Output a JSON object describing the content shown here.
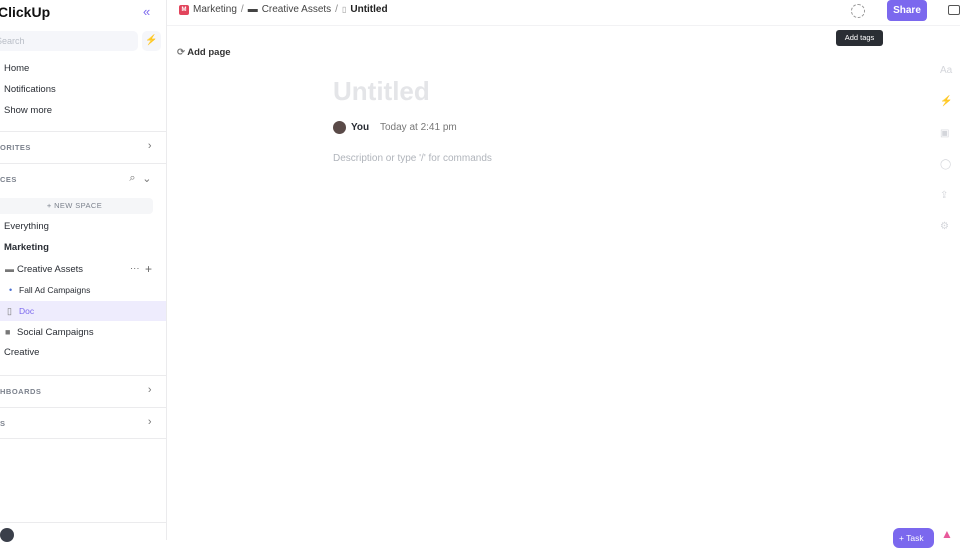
{
  "sidebar": {
    "logo": "ClickUp",
    "search_placeholder": "Search",
    "nav": [
      "Home",
      "Notifications",
      "Show more"
    ],
    "favorites": "ORITES",
    "spaces": "CES",
    "new_space": "+ NEW SPACE",
    "tree": [
      "Everything",
      "Marketing",
      "Creative Assets",
      "Fall Ad Campaigns",
      "Doc",
      "Social Campaigns",
      "Creative"
    ],
    "dashboards": "HBOARDS",
    "last_section": "S"
  },
  "header": {
    "crumbs": [
      "Marketing",
      "Creative Assets",
      "Untitled"
    ],
    "share": "Share",
    "tooltip": "Add tags"
  },
  "doc": {
    "add_page": "Add page",
    "title": "Untitled",
    "author": "You",
    "time": "Today at 2:41 pm",
    "placeholder": "Description or type '/' for commands",
    "rail_text": "Aa"
  },
  "task_button": "+ Task",
  "accent": "#7b68ee"
}
